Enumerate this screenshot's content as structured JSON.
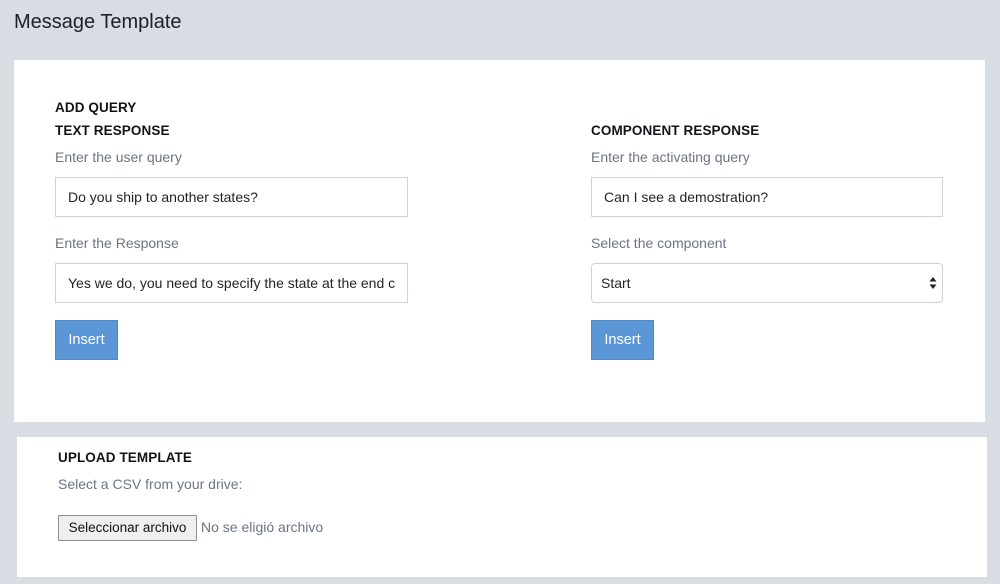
{
  "page": {
    "title": "Message Template"
  },
  "add_query": {
    "heading": "ADD QUERY",
    "text_response": {
      "heading": "TEXT RESPONSE",
      "query_label": "Enter the user query",
      "query_value": "Do you ship to another states?",
      "response_label": "Enter the Response",
      "response_value": "Yes we do, you need to specify the state at the end c",
      "insert_label": "Insert"
    },
    "component_response": {
      "heading": "COMPONENT RESPONSE",
      "query_label": "Enter the activating query",
      "query_value": "Can I see a demostration?",
      "component_label": "Select the component",
      "component_selected": "Start",
      "insert_label": "Insert"
    }
  },
  "upload": {
    "heading": "UPLOAD TEMPLATE",
    "label": "Select a CSV from your drive:",
    "file_button_label": "Seleccionar archivo",
    "file_status": "No se eligió archivo"
  },
  "colors": {
    "background": "#d8dce3",
    "button_primary": "#5b96d6",
    "card": "#ffffff"
  }
}
